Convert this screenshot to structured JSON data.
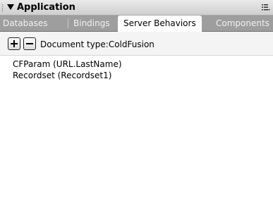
{
  "panel": {
    "title": "Application"
  },
  "tabs": [
    {
      "label": "Databases",
      "active": false
    },
    {
      "label": "Bindings",
      "active": false
    },
    {
      "label": "Server Behaviors",
      "active": true
    },
    {
      "label": "Components",
      "active": false
    }
  ],
  "toolbar": {
    "add_icon": "plus-icon",
    "remove_icon": "minus-icon",
    "document_type": "Document type:ColdFusion"
  },
  "behaviors": [
    {
      "label": "CFParam (URL.LastName)"
    },
    {
      "label": "Recordset (Recordset1)"
    }
  ],
  "colors": {
    "tabbar": "#9e9e9e",
    "active_tab": "#ffffff",
    "titlebar": "#d9d9d9"
  }
}
